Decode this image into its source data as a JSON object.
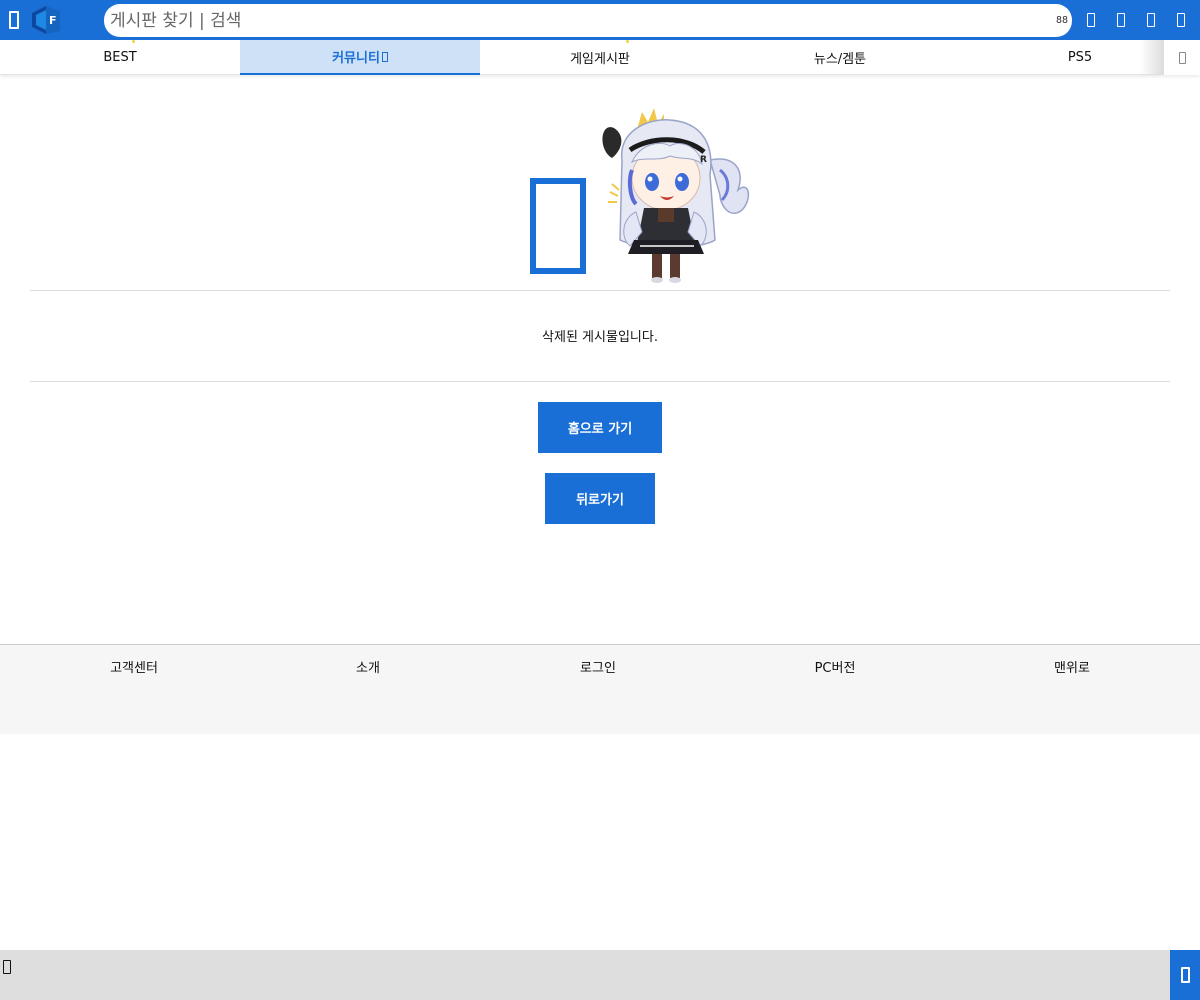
{
  "header": {
    "search_placeholder": "게시판 찾기 | 검색",
    "scan_icon_text": "88",
    "icons": [
      "menu-icon",
      "logo-icon",
      "scan-icon",
      "notification-icon",
      "chat-icon",
      "bookmark-icon",
      "user-icon"
    ]
  },
  "nav": {
    "tabs": [
      {
        "label": "BEST"
      },
      {
        "label": "커뮤니티"
      },
      {
        "label": "게임게시판"
      },
      {
        "label": "뉴스/겜툰"
      },
      {
        "label": "PS5"
      }
    ],
    "active_tab": 1,
    "more_icon": "more-icon"
  },
  "main": {
    "message": "삭제된 게시물입니다.",
    "home_button": "홈으로 가기",
    "back_button": "뒤로가기"
  },
  "footer": {
    "links": [
      "고객센터",
      "소개",
      "로그인",
      "PC버전",
      "맨위로"
    ]
  },
  "colors": {
    "brand_blue": "#1a6fd6",
    "active_tab_bg": "#cfe1f7",
    "footer_bg": "#f6f6f6",
    "bottom_bar_bg": "#dedede"
  }
}
